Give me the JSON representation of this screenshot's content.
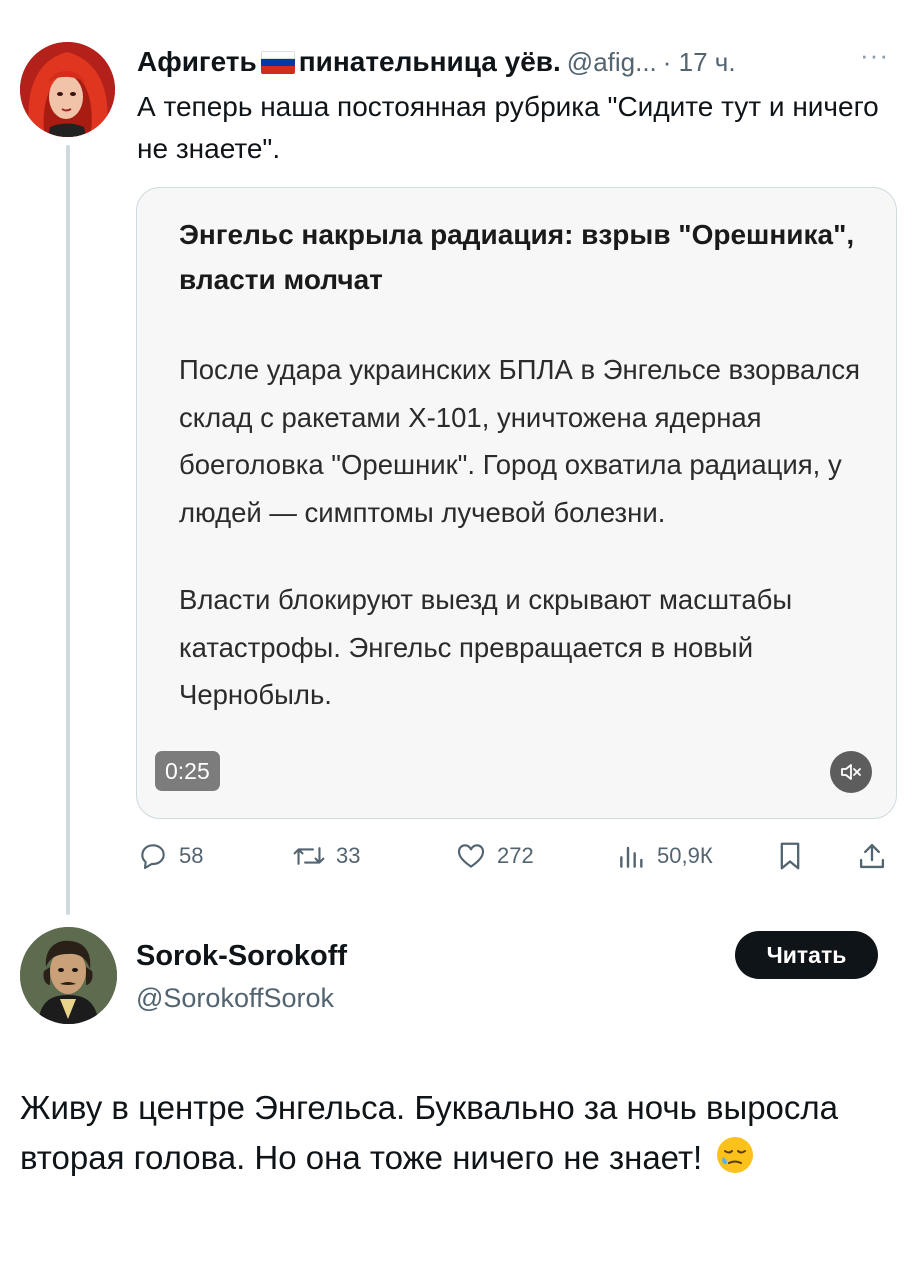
{
  "tweet": {
    "author_name_part1": "Афигеть",
    "author_name_part2": "пинательница уёв.",
    "handle": "@afig...",
    "time": "· 17 ч.",
    "more": "···",
    "text": "А теперь наша постоянная рубрика \"Сидите тут и ничего не знаете\"."
  },
  "video_card": {
    "title": "Энгельс накрыла радиация: взрыв \"Орешника\", власти молчат",
    "paragraph1": "После удара украинских БПЛА в Энгельсе взорвался склад с ракетами Х-101, уничтожена ядерная боеголовка \"Орешник\". Город охватила радиация, у людей — симптомы лучевой болезни.",
    "paragraph2": "Власти блокируют выезд и скрывают масштабы катастрофы. Энгельс превращается в новый Чернобыль.",
    "timer": "0:25",
    "mute_icon": "speaker-muted-icon"
  },
  "actions": {
    "replies": "58",
    "reposts": "33",
    "likes": "272",
    "views": "50,9К"
  },
  "reply": {
    "author_name": "Sorok-Sorokoff",
    "handle": "@SorokoffSorok",
    "follow_label": "Читать",
    "text": "Живу в центре Энгельса. Буквально за ночь выросла вторая голова. Но она тоже ничего не знает!",
    "emoji": "sleepy-face-emoji"
  },
  "colors": {
    "text": "#0f1419",
    "secondary": "#536471",
    "border": "#cfd9de",
    "card_bg": "#f7f7f7",
    "follow_button_bg": "#0f1419"
  }
}
